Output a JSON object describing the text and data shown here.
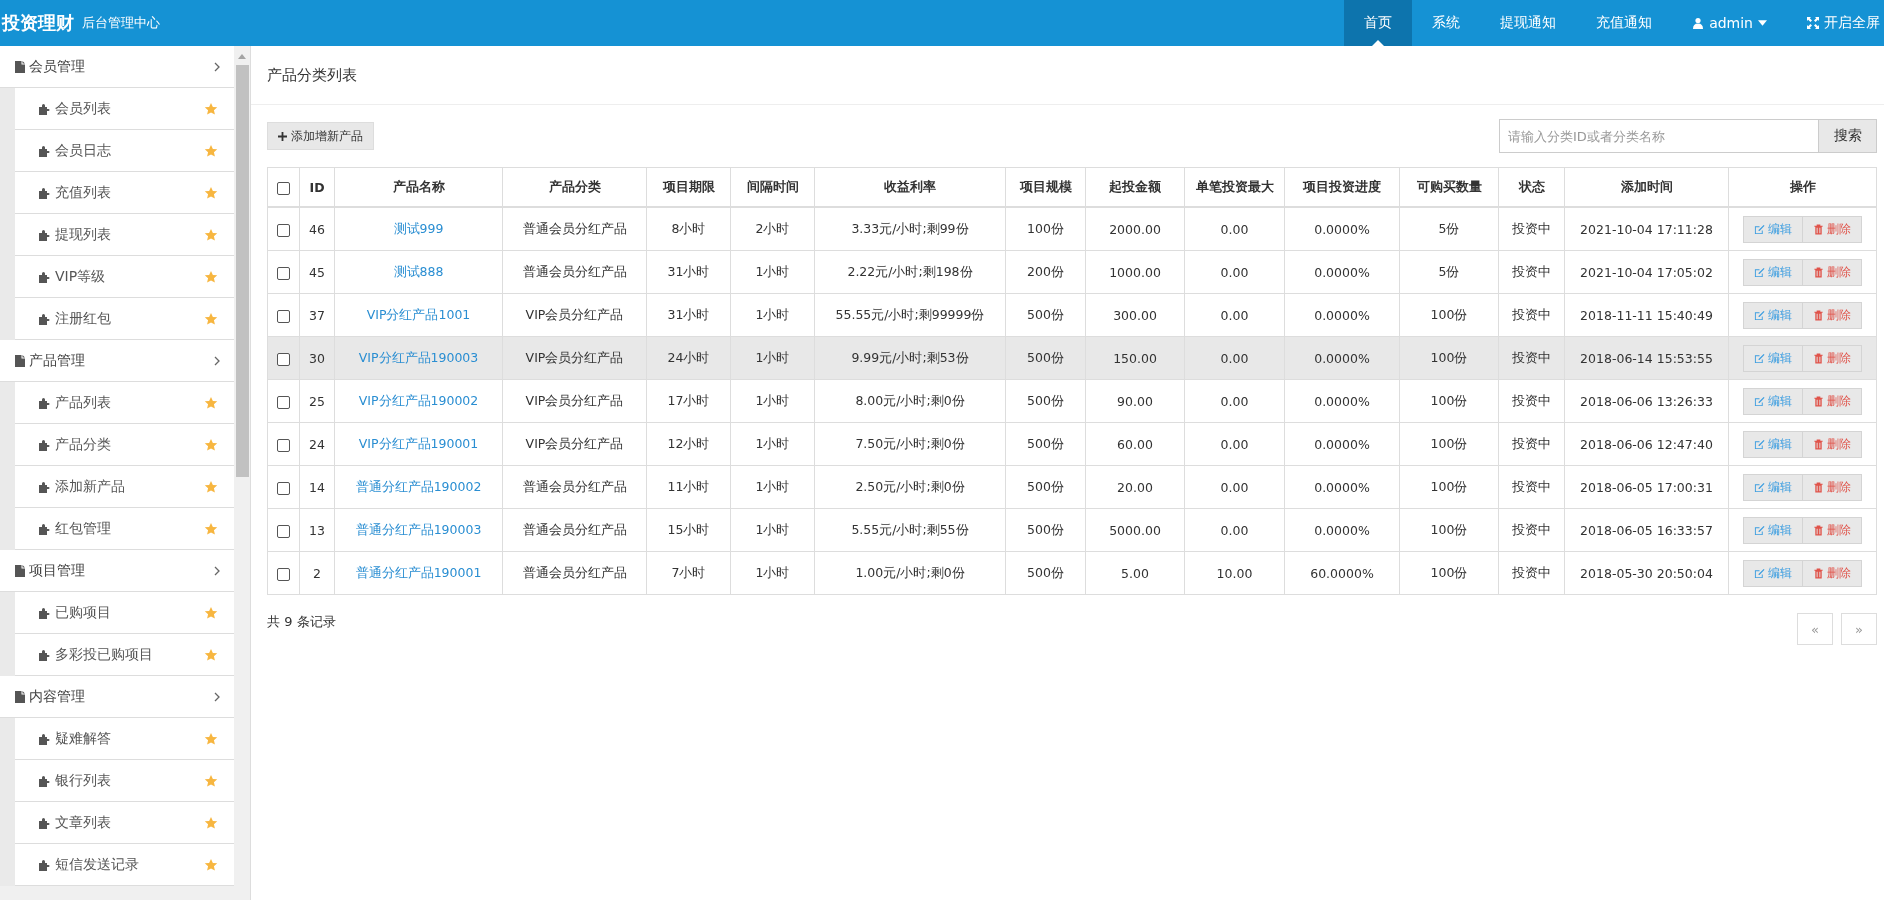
{
  "header": {
    "logo": "投资理财",
    "subtitle": "后台管理中心",
    "nav": [
      {
        "label": "首页",
        "kind": "text",
        "selected": true
      },
      {
        "label": "系统",
        "kind": "text",
        "selected": false
      },
      {
        "label": "提现通知",
        "kind": "text",
        "selected": false
      },
      {
        "label": "充值通知",
        "kind": "text",
        "selected": false
      },
      {
        "label": "admin",
        "kind": "user",
        "selected": false
      },
      {
        "label": "开启全屏",
        "kind": "fullscreen",
        "selected": false
      }
    ]
  },
  "sidebar": {
    "groups": [
      {
        "label": "会员管理",
        "expanded": true,
        "children": [
          {
            "label": "会员列表"
          },
          {
            "label": "会员日志"
          },
          {
            "label": "充值列表"
          },
          {
            "label": "提现列表"
          },
          {
            "label": "VIP等级"
          },
          {
            "label": "注册红包"
          }
        ]
      },
      {
        "label": "产品管理",
        "expanded": true,
        "children": [
          {
            "label": "产品列表"
          },
          {
            "label": "产品分类"
          },
          {
            "label": "添加新产品"
          },
          {
            "label": "红包管理"
          }
        ]
      },
      {
        "label": "项目管理",
        "expanded": true,
        "children": [
          {
            "label": "已购项目"
          },
          {
            "label": "多彩投已购项目"
          }
        ]
      },
      {
        "label": "内容管理",
        "expanded": true,
        "children": [
          {
            "label": "疑难解答"
          },
          {
            "label": "银行列表"
          },
          {
            "label": "文章列表"
          },
          {
            "label": "短信发送记录"
          }
        ]
      }
    ]
  },
  "page_title": "产品分类列表",
  "add_button": "添加增新产品",
  "search": {
    "placeholder": "请输入分类ID或者分类名称",
    "button": "搜索"
  },
  "table": {
    "header_checked": false,
    "columns": [
      "ID",
      "产品名称",
      "产品分类",
      "项目期限",
      "间隔时间",
      "收益利率",
      "项目规模",
      "起投金额",
      "单笔投资最大",
      "项目投资进度",
      "可购买数量",
      "状态",
      "添加时间",
      "操作"
    ],
    "rows": [
      {
        "selected": false,
        "checked": false,
        "cells": [
          "46",
          "测试999",
          "普通会员分红产品",
          "8小时",
          "2小时",
          "3.33元/小时;剩99份",
          "100份",
          "2000.00",
          "0.00",
          "0.0000%",
          "5份",
          "投资中",
          "2021-10-04 17:11:28"
        ],
        "edit": "编辑",
        "delete": "删除"
      },
      {
        "selected": false,
        "checked": false,
        "cells": [
          "45",
          "测试888",
          "普通会员分红产品",
          "31小时",
          "1小时",
          "2.22元/小时;剩198份",
          "200份",
          "1000.00",
          "0.00",
          "0.0000%",
          "5份",
          "投资中",
          "2021-10-04 17:05:02"
        ],
        "edit": "编辑",
        "delete": "删除"
      },
      {
        "selected": false,
        "checked": false,
        "cells": [
          "37",
          "VIP分红产品1001",
          "VIP会员分红产品",
          "31小时",
          "1小时",
          "55.55元/小时;剩99999份",
          "500份",
          "300.00",
          "0.00",
          "0.0000%",
          "100份",
          "投资中",
          "2018-11-11 15:40:49"
        ],
        "edit": "编辑",
        "delete": "删除"
      },
      {
        "selected": true,
        "checked": false,
        "cells": [
          "30",
          "VIP分红产品190003",
          "VIP会员分红产品",
          "24小时",
          "1小时",
          "9.99元/小时;剩53份",
          "500份",
          "150.00",
          "0.00",
          "0.0000%",
          "100份",
          "投资中",
          "2018-06-14 15:53:55"
        ],
        "edit": "编辑",
        "delete": "删除"
      },
      {
        "selected": false,
        "checked": false,
        "cells": [
          "25",
          "VIP分红产品190002",
          "VIP会员分红产品",
          "17小时",
          "1小时",
          "8.00元/小时;剩0份",
          "500份",
          "90.00",
          "0.00",
          "0.0000%",
          "100份",
          "投资中",
          "2018-06-06 13:26:33"
        ],
        "edit": "编辑",
        "delete": "删除"
      },
      {
        "selected": false,
        "checked": false,
        "cells": [
          "24",
          "VIP分红产品190001",
          "VIP会员分红产品",
          "12小时",
          "1小时",
          "7.50元/小时;剩0份",
          "500份",
          "60.00",
          "0.00",
          "0.0000%",
          "100份",
          "投资中",
          "2018-06-06 12:47:40"
        ],
        "edit": "编辑",
        "delete": "删除"
      },
      {
        "selected": false,
        "checked": false,
        "cells": [
          "14",
          "普通分红产品190002",
          "普通会员分红产品",
          "11小时",
          "1小时",
          "2.50元/小时;剩0份",
          "500份",
          "20.00",
          "0.00",
          "0.0000%",
          "100份",
          "投资中",
          "2018-06-05 17:00:31"
        ],
        "edit": "编辑",
        "delete": "删除"
      },
      {
        "selected": false,
        "checked": false,
        "cells": [
          "13",
          "普通分红产品190003",
          "普通会员分红产品",
          "15小时",
          "1小时",
          "5.55元/小时;剩55份",
          "500份",
          "5000.00",
          "0.00",
          "0.0000%",
          "100份",
          "投资中",
          "2018-06-05 16:33:57"
        ],
        "edit": "编辑",
        "delete": "删除"
      },
      {
        "selected": false,
        "checked": false,
        "cells": [
          "2",
          "普通分红产品190001",
          "普通会员分红产品",
          "7小时",
          "1小时",
          "1.00元/小时;剩0份",
          "500份",
          "5.00",
          "10.00",
          "60.0000%",
          "100份",
          "投资中",
          "2018-05-30 20:50:04"
        ],
        "edit": "编辑",
        "delete": "删除"
      }
    ]
  },
  "record_count": "共 9 条记录",
  "pagination": {
    "prev": "«",
    "next": "»"
  }
}
